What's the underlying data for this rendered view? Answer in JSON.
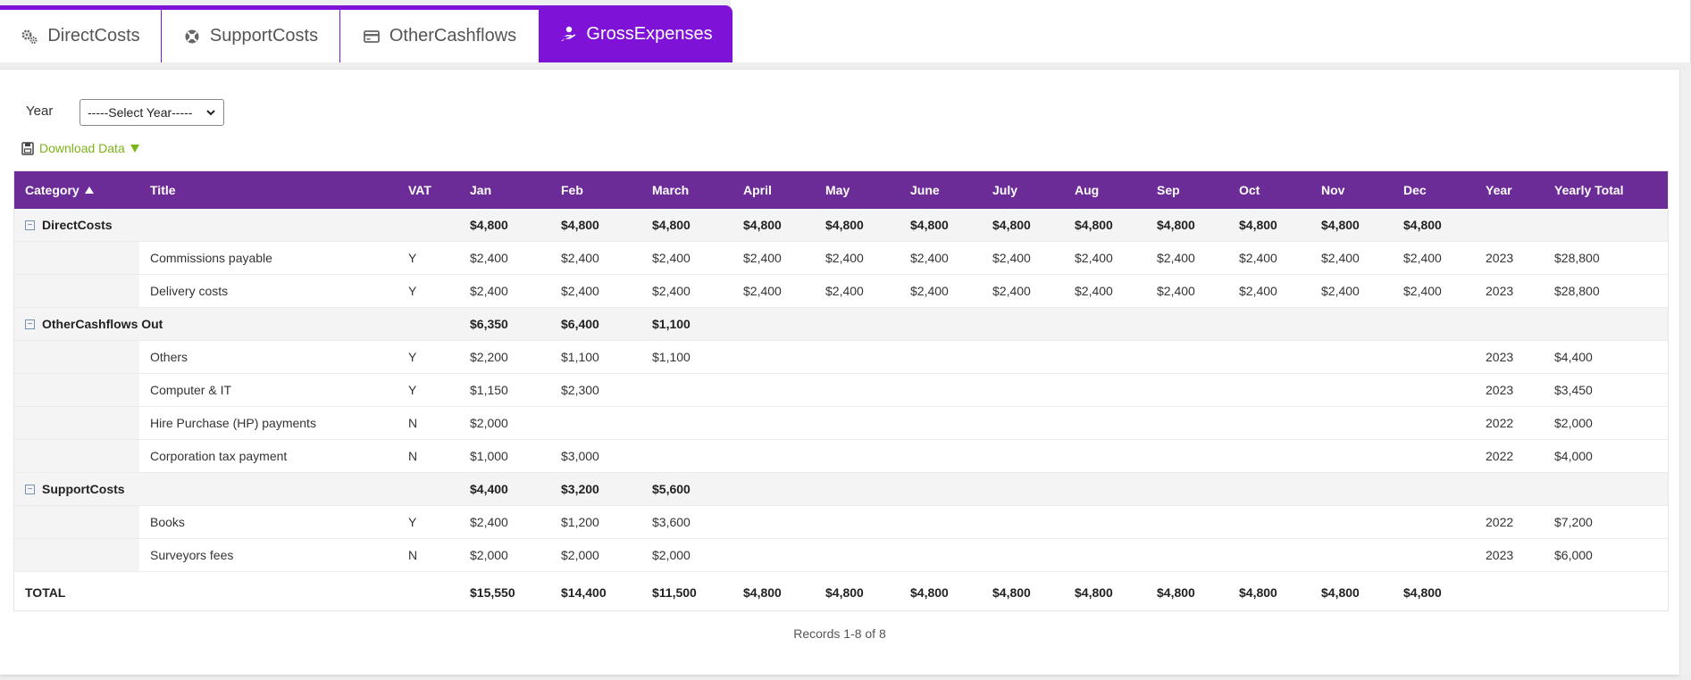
{
  "tabs": [
    {
      "id": "t1",
      "label": "DirectCosts",
      "icon": "gears-icon",
      "active": false
    },
    {
      "id": "t2",
      "label": "SupportCosts",
      "icon": "support-icon",
      "active": false
    },
    {
      "id": "t3",
      "label": "OtherCashflows",
      "icon": "credit-card-icon",
      "active": false
    },
    {
      "id": "t4",
      "label": "GrossExpenses",
      "icon": "hand-money-icon",
      "active": true
    }
  ],
  "filters": {
    "year_label": "Year",
    "year_select_value": "-----Select Year-----"
  },
  "download_label": "Download Data",
  "columns": [
    "Category",
    "Title",
    "VAT",
    "Jan",
    "Feb",
    "March",
    "April",
    "May",
    "June",
    "July",
    "Aug",
    "Sep",
    "Oct",
    "Nov",
    "Dec",
    "Year",
    "Yearly Total"
  ],
  "sort": {
    "column": "Category",
    "direction": "asc"
  },
  "rows": [
    {
      "type": "group",
      "category": "DirectCosts",
      "months": [
        "$4,800",
        "$4,800",
        "$4,800",
        "$4,800",
        "$4,800",
        "$4,800",
        "$4,800",
        "$4,800",
        "$4,800",
        "$4,800",
        "$4,800",
        "$4,800"
      ],
      "year": "",
      "total": ""
    },
    {
      "type": "detail",
      "title": "Commissions payable",
      "vat": "Y",
      "months": [
        "$2,400",
        "$2,400",
        "$2,400",
        "$2,400",
        "$2,400",
        "$2,400",
        "$2,400",
        "$2,400",
        "$2,400",
        "$2,400",
        "$2,400",
        "$2,400"
      ],
      "year": "2023",
      "total": "$28,800"
    },
    {
      "type": "detail",
      "title": "Delivery costs",
      "vat": "Y",
      "months": [
        "$2,400",
        "$2,400",
        "$2,400",
        "$2,400",
        "$2,400",
        "$2,400",
        "$2,400",
        "$2,400",
        "$2,400",
        "$2,400",
        "$2,400",
        "$2,400"
      ],
      "year": "2023",
      "total": "$28,800"
    },
    {
      "type": "group",
      "category": "OtherCashflows Out",
      "months": [
        "$6,350",
        "$6,400",
        "$1,100",
        "",
        "",
        "",
        "",
        "",
        "",
        "",
        "",
        ""
      ],
      "year": "",
      "total": ""
    },
    {
      "type": "detail",
      "title": "Others",
      "vat": "Y",
      "months": [
        "$2,200",
        "$1,100",
        "$1,100",
        "",
        "",
        "",
        "",
        "",
        "",
        "",
        "",
        ""
      ],
      "year": "2023",
      "total": "$4,400"
    },
    {
      "type": "detail",
      "title": "Computer & IT",
      "vat": "Y",
      "months": [
        "$1,150",
        "$2,300",
        "",
        "",
        "",
        "",
        "",
        "",
        "",
        "",
        "",
        ""
      ],
      "year": "2023",
      "total": "$3,450"
    },
    {
      "type": "detail",
      "title": "Hire Purchase (HP) payments",
      "vat": "N",
      "months": [
        "$2,000",
        "",
        "",
        "",
        "",
        "",
        "",
        "",
        "",
        "",
        "",
        ""
      ],
      "year": "2022",
      "total": "$2,000"
    },
    {
      "type": "detail",
      "title": "Corporation tax payment",
      "vat": "N",
      "months": [
        "$1,000",
        "$3,000",
        "",
        "",
        "",
        "",
        "",
        "",
        "",
        "",
        "",
        ""
      ],
      "year": "2022",
      "total": "$4,000"
    },
    {
      "type": "group",
      "category": "SupportCosts",
      "months": [
        "$4,400",
        "$3,200",
        "$5,600",
        "",
        "",
        "",
        "",
        "",
        "",
        "",
        "",
        ""
      ],
      "year": "",
      "total": ""
    },
    {
      "type": "detail",
      "title": "Books",
      "vat": "Y",
      "months": [
        "$2,400",
        "$1,200",
        "$3,600",
        "",
        "",
        "",
        "",
        "",
        "",
        "",
        "",
        ""
      ],
      "year": "2022",
      "total": "$7,200"
    },
    {
      "type": "detail",
      "title": "Surveyors fees",
      "vat": "N",
      "months": [
        "$2,000",
        "$2,000",
        "$2,000",
        "",
        "",
        "",
        "",
        "",
        "",
        "",
        "",
        ""
      ],
      "year": "2023",
      "total": "$6,000"
    }
  ],
  "total_row": {
    "label": "TOTAL",
    "months": [
      "$15,550",
      "$14,400",
      "$11,500",
      "$4,800",
      "$4,800",
      "$4,800",
      "$4,800",
      "$4,800",
      "$4,800",
      "$4,800",
      "$4,800",
      "$4,800"
    ]
  },
  "records_text": "Records 1-8 of 8",
  "colors": {
    "tab_active": "#7e12d6",
    "header_bg": "#6c2c97",
    "download_link": "#7cb518"
  }
}
